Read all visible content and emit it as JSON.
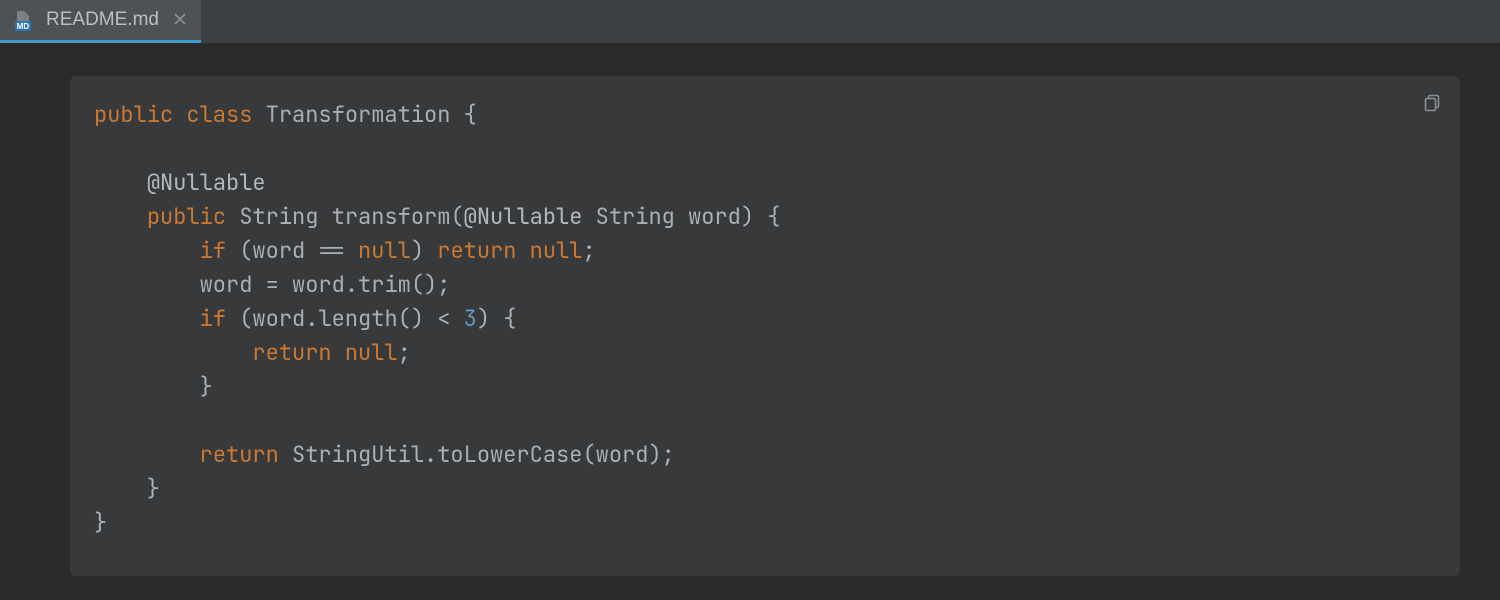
{
  "tab": {
    "filename": "README.md",
    "icon_badge": "MD"
  },
  "code": {
    "tokens": [
      {
        "t": "public",
        "c": "tk-keyword"
      },
      {
        "t": " ",
        "c": "tk-punct"
      },
      {
        "t": "class",
        "c": "tk-keyword"
      },
      {
        "t": " ",
        "c": "tk-punct"
      },
      {
        "t": "Transformation",
        "c": "tk-ident"
      },
      {
        "t": " {",
        "c": "tk-punct"
      },
      {
        "t": "\n",
        "c": ""
      },
      {
        "t": "\n",
        "c": ""
      },
      {
        "t": "    ",
        "c": ""
      },
      {
        "t": "@Nullable",
        "c": "tk-annot"
      },
      {
        "t": "\n",
        "c": ""
      },
      {
        "t": "    ",
        "c": ""
      },
      {
        "t": "public",
        "c": "tk-keyword"
      },
      {
        "t": " ",
        "c": ""
      },
      {
        "t": "String",
        "c": "tk-ident"
      },
      {
        "t": " ",
        "c": ""
      },
      {
        "t": "transform",
        "c": "tk-ident"
      },
      {
        "t": "(",
        "c": "tk-punct"
      },
      {
        "t": "@Nullable",
        "c": "tk-annot"
      },
      {
        "t": " ",
        "c": ""
      },
      {
        "t": "String",
        "c": "tk-ident"
      },
      {
        "t": " ",
        "c": ""
      },
      {
        "t": "word",
        "c": "tk-ident"
      },
      {
        "t": ") {",
        "c": "tk-punct"
      },
      {
        "t": "\n",
        "c": ""
      },
      {
        "t": "        ",
        "c": ""
      },
      {
        "t": "if",
        "c": "tk-keyword"
      },
      {
        "t": " (",
        "c": "tk-punct"
      },
      {
        "t": "word",
        "c": "tk-ident"
      },
      {
        "t": " == ",
        "c": "tk-punct"
      },
      {
        "t": "null",
        "c": "tk-null"
      },
      {
        "t": ") ",
        "c": "tk-punct"
      },
      {
        "t": "return",
        "c": "tk-keyword"
      },
      {
        "t": " ",
        "c": ""
      },
      {
        "t": "null",
        "c": "tk-null"
      },
      {
        "t": ";",
        "c": "tk-punct"
      },
      {
        "t": "\n",
        "c": ""
      },
      {
        "t": "        ",
        "c": ""
      },
      {
        "t": "word",
        "c": "tk-ident"
      },
      {
        "t": " = ",
        "c": "tk-punct"
      },
      {
        "t": "word",
        "c": "tk-ident"
      },
      {
        "t": ".",
        "c": "tk-punct"
      },
      {
        "t": "trim",
        "c": "tk-ident"
      },
      {
        "t": "();",
        "c": "tk-punct"
      },
      {
        "t": "\n",
        "c": ""
      },
      {
        "t": "        ",
        "c": ""
      },
      {
        "t": "if",
        "c": "tk-keyword"
      },
      {
        "t": " (",
        "c": "tk-punct"
      },
      {
        "t": "word",
        "c": "tk-ident"
      },
      {
        "t": ".",
        "c": "tk-punct"
      },
      {
        "t": "length",
        "c": "tk-ident"
      },
      {
        "t": "() < ",
        "c": "tk-punct"
      },
      {
        "t": "3",
        "c": "tk-number"
      },
      {
        "t": ") {",
        "c": "tk-punct"
      },
      {
        "t": "\n",
        "c": ""
      },
      {
        "t": "            ",
        "c": ""
      },
      {
        "t": "return",
        "c": "tk-keyword"
      },
      {
        "t": " ",
        "c": ""
      },
      {
        "t": "null",
        "c": "tk-null"
      },
      {
        "t": ";",
        "c": "tk-punct"
      },
      {
        "t": "\n",
        "c": ""
      },
      {
        "t": "        }",
        "c": "tk-punct"
      },
      {
        "t": "\n",
        "c": ""
      },
      {
        "t": "\n",
        "c": ""
      },
      {
        "t": "        ",
        "c": ""
      },
      {
        "t": "return",
        "c": "tk-keyword"
      },
      {
        "t": " ",
        "c": ""
      },
      {
        "t": "StringUtil",
        "c": "tk-ident"
      },
      {
        "t": ".",
        "c": "tk-punct"
      },
      {
        "t": "toLowerCase",
        "c": "tk-ident"
      },
      {
        "t": "(",
        "c": "tk-punct"
      },
      {
        "t": "word",
        "c": "tk-ident"
      },
      {
        "t": ");",
        "c": "tk-punct"
      },
      {
        "t": "\n",
        "c": ""
      },
      {
        "t": "    }",
        "c": "tk-punct"
      },
      {
        "t": "\n",
        "c": ""
      },
      {
        "t": "}",
        "c": "tk-punct"
      }
    ]
  }
}
